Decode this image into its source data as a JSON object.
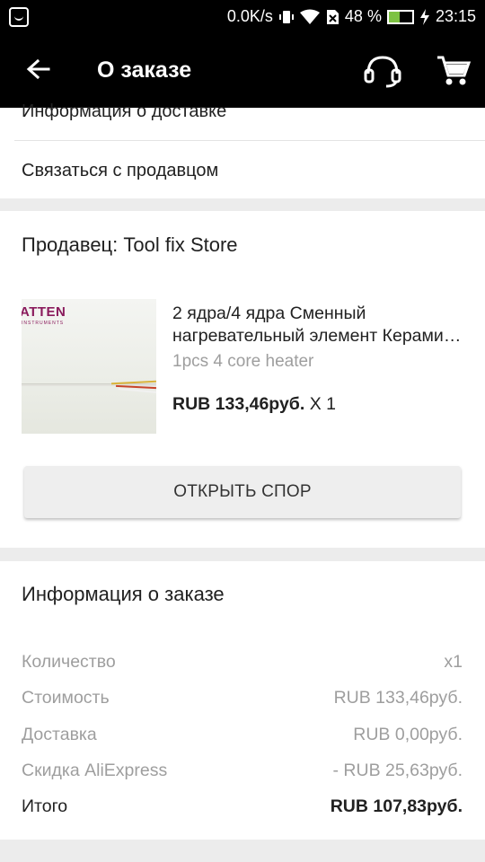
{
  "status_bar": {
    "speed": "0.0K/s",
    "battery_percent": "48 %",
    "battery_level": 0.48,
    "time": "23:15"
  },
  "toolbar": {
    "title": "О заказе"
  },
  "top_links": {
    "delivery_info": "Информация о доставке",
    "contact_seller": "Связаться с продавцом"
  },
  "seller": {
    "label": "Продавец: Tool fix Store"
  },
  "product": {
    "image_brand": "ATTEN",
    "image_brand_sub": "INSTRUMENTS",
    "title_line1": "2 ядра/4 ядра Сменный",
    "title_line2": "нагревательный элемент Керамический",
    "sku": "1pcs 4 core heater",
    "price": "RUB 133,46руб.",
    "qty": "X 1"
  },
  "dispute_button": "ОТКРЫТЬ СПОР",
  "order_info": {
    "title": "Информация о заказе",
    "rows": [
      {
        "label": "Количество",
        "value": "x1"
      },
      {
        "label": "Стоимость",
        "value": "RUB 133,46руб."
      },
      {
        "label": "Доставка",
        "value": "RUB 0,00руб."
      },
      {
        "label": "Скидка AliExpress",
        "value": "- RUB 25,63руб."
      },
      {
        "label": "Итого",
        "value": "RUB 107,83руб."
      }
    ]
  },
  "colors": {
    "toolbar_bg": "#000000",
    "battery_fill": "#7dc242",
    "muted_text": "#9e9e9e"
  }
}
